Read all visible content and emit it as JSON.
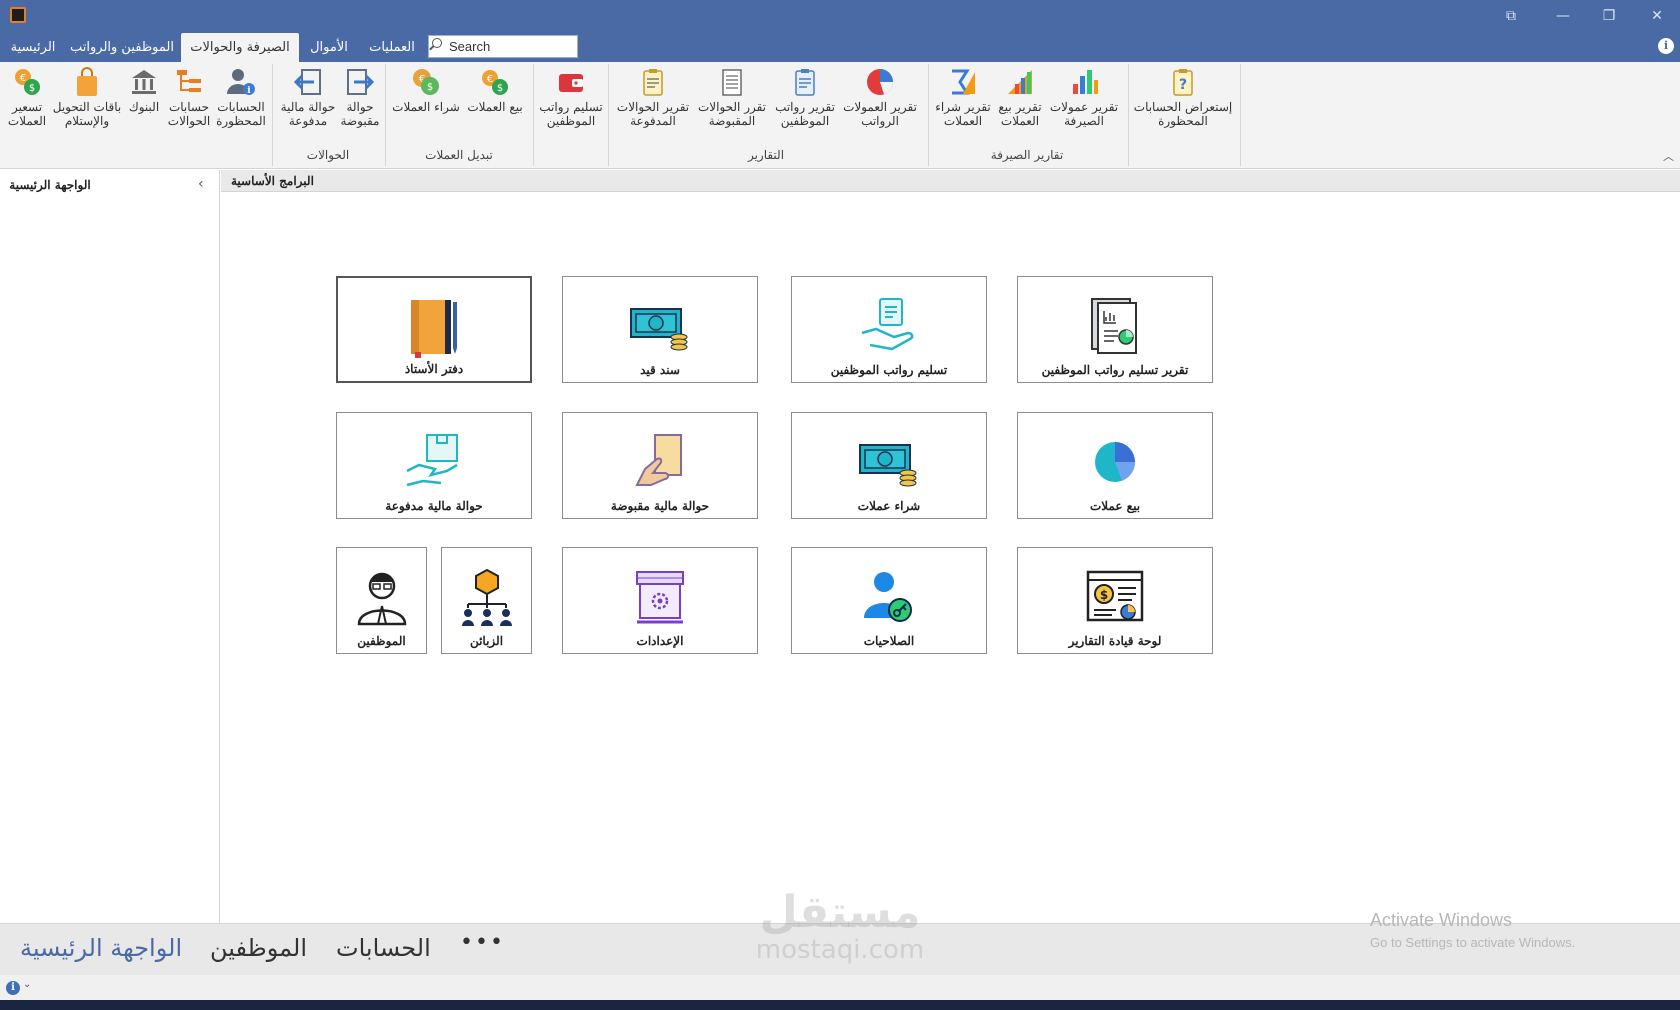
{
  "window": {
    "controls": {
      "restore_panel": "⧉",
      "minimize": "—",
      "maximize": "❐",
      "close": "✕"
    }
  },
  "tabs": [
    {
      "label": "الرئيسية"
    },
    {
      "label": "الموظفين والرواتب"
    },
    {
      "label": "الصيرفة والحوالات"
    },
    {
      "label": "الأموال"
    },
    {
      "label": "العمليات"
    }
  ],
  "active_tab": "الصيرفة والحوالات",
  "search": {
    "value": "Search"
  },
  "ribbon": {
    "buttons": [
      {
        "label": "تسعير\nالعملات",
        "icon": "currency-exchange-icon"
      },
      {
        "label": "باقات التحويل\nوالإستلام",
        "icon": "shopping-bag-icon"
      },
      {
        "label": "البنوك",
        "icon": "bank-icon"
      },
      {
        "label": "حسابات\nالحوالات",
        "icon": "tree-accounts-icon"
      },
      {
        "label": "الحسابات\nالمحظورة",
        "icon": "user-info-icon"
      },
      {
        "label": "حوالة مالية\nمدفوعة",
        "icon": "arrow-left-box-icon"
      },
      {
        "label": "حوالة\nمقبوضة",
        "icon": "arrow-right-box-icon"
      },
      {
        "label": "شراء العملات",
        "icon": "coin-buy-icon"
      },
      {
        "label": "بيع العملات",
        "icon": "coin-sell-icon"
      },
      {
        "label": "تسليم رواتب\nالموظفين",
        "icon": "wallet-icon"
      },
      {
        "label": "تقرير الحوالات\nالمدفوعة",
        "icon": "clipboard-report-icon"
      },
      {
        "label": "تقرر الحوالات\nالمقبوضة",
        "icon": "document-report-icon"
      },
      {
        "label": "تقرير رواتب\nالموظفين",
        "icon": "clipboard-report-icon"
      },
      {
        "label": "تقرير العمولات\nالرواتب",
        "icon": "pie-chart-icon"
      },
      {
        "label": "تقرير شراء\nالعملات",
        "icon": "sigma-chart-icon"
      },
      {
        "label": "تقرير بيع\nالعملات",
        "icon": "bar-chart-triangle-icon"
      },
      {
        "label": "تقرير عمولات\nالصيرفة",
        "icon": "bar-chart-icon"
      },
      {
        "label": "إستعراض الحسابات\nالمحظورة",
        "icon": "clipboard-question-icon"
      }
    ],
    "groups": [
      {
        "label": "الحوالات"
      },
      {
        "label": "تبديل العملات"
      },
      {
        "label": "التقارير"
      },
      {
        "label": "تقارير الصيرفة"
      }
    ]
  },
  "left_panel": {
    "title": "الواجهة الرئيسية"
  },
  "main": {
    "header": "البرامج الأساسية",
    "tiles": [
      {
        "label": "دفتر الأستاذ",
        "icon": "ledger-book-icon"
      },
      {
        "label": "سند قيد",
        "icon": "cash-coins-icon"
      },
      {
        "label": "تسليم رواتب الموظفين",
        "icon": "hand-receipt-icon"
      },
      {
        "label": "تقرير تسليم رواتب الموظفين",
        "icon": "report-document-icon"
      },
      {
        "label": "حوالة مالية مدفوعة",
        "icon": "hand-box-icon"
      },
      {
        "label": "حوالة مالية مقبوضة",
        "icon": "hand-card-icon"
      },
      {
        "label": "شراء عملات",
        "icon": "cash-coins-icon"
      },
      {
        "label": "بيع عملات",
        "icon": "pie-chart-icon"
      },
      {
        "label": "الموظفين",
        "icon": "employee-icon"
      },
      {
        "label": "الزبائن",
        "icon": "customers-network-icon"
      },
      {
        "label": "الإعدادات",
        "icon": "store-settings-icon"
      },
      {
        "label": "الصلاحيات",
        "icon": "user-key-icon"
      },
      {
        "label": "لوحة قيادة التقارير",
        "icon": "dashboard-report-icon"
      }
    ]
  },
  "bottom_nav": {
    "items": [
      {
        "label": "الواجهة الرئيسية"
      },
      {
        "label": "الموظفين"
      },
      {
        "label": "الحسابات"
      }
    ],
    "more": "•••"
  },
  "watermarks": {
    "activate_title": "Activate Windows",
    "activate_sub": "Go to Settings to activate Windows.",
    "site_ar": "مستقل",
    "site_en": "mostaqi.com"
  },
  "status": {
    "info": "i",
    "chevron": "⌄"
  },
  "colors": {
    "accent": "#4a6aa5",
    "ribbon_bg": "#f3f3f3"
  }
}
